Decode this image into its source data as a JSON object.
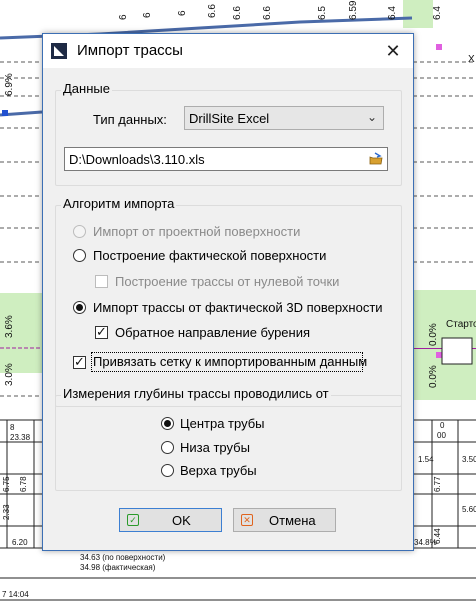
{
  "dialog": {
    "title": "Импорт трассы",
    "close_glyph": "✕",
    "data_group": {
      "label": "Данные",
      "type_label": "Тип данных:",
      "type_value": "DrillSite Excel",
      "file_path": "D:\\Downloads\\3.110.xls"
    },
    "algo_group": {
      "label": "Алгоритм импорта",
      "options": [
        {
          "label": "Импорт от проектной поверхности",
          "selected": false,
          "enabled": false
        },
        {
          "label": "Построение фактической поверхности",
          "selected": false,
          "enabled": true
        },
        {
          "label": "Построение трассы от нулевой точки",
          "checked": false,
          "enabled": false
        },
        {
          "label": "Импорт трассы от фактической 3D поверхности",
          "selected": true,
          "enabled": true
        },
        {
          "label": "Обратное направление бурения",
          "checked": true,
          "enabled": true
        }
      ]
    },
    "snap_checkbox": {
      "label": "Привязать сетку к импортированным данным",
      "checked": true
    },
    "depth_group": {
      "label": "Измерения глубины трассы проводились от",
      "options": [
        {
          "label": "Центра трубы",
          "selected": true
        },
        {
          "label": "Низа трубы",
          "selected": false
        },
        {
          "label": "Верха трубы",
          "selected": false
        }
      ]
    },
    "buttons": {
      "ok": "OK",
      "cancel": "Отмена"
    }
  },
  "background": {
    "top_labels": [
      "6",
      "6",
      "6",
      "6.6",
      "6.6",
      "6.6",
      "6.5",
      "6.4",
      "6.59",
      "6.4"
    ],
    "left_slope_top": "6.9%",
    "left_slope_mid": "3.6%",
    "left_slope_low": "3.0%",
    "right_slope": "0.0%",
    "right_slope_low": "0.0%",
    "right_label": "Стартов",
    "x_label": "X",
    "bottom_values": [
      "8",
      "23.38",
      "6.75",
      "6.78",
      "2.33",
      "6.20",
      "0",
      "00",
      "1.54",
      "3.50",
      "5.60",
      "6.77",
      "6.44",
      "34.8%"
    ],
    "surface_note_1": "34.63  (по поверхности)",
    "surface_note_2": "34.98  (фактическая)",
    "footer": "7   14:04"
  }
}
